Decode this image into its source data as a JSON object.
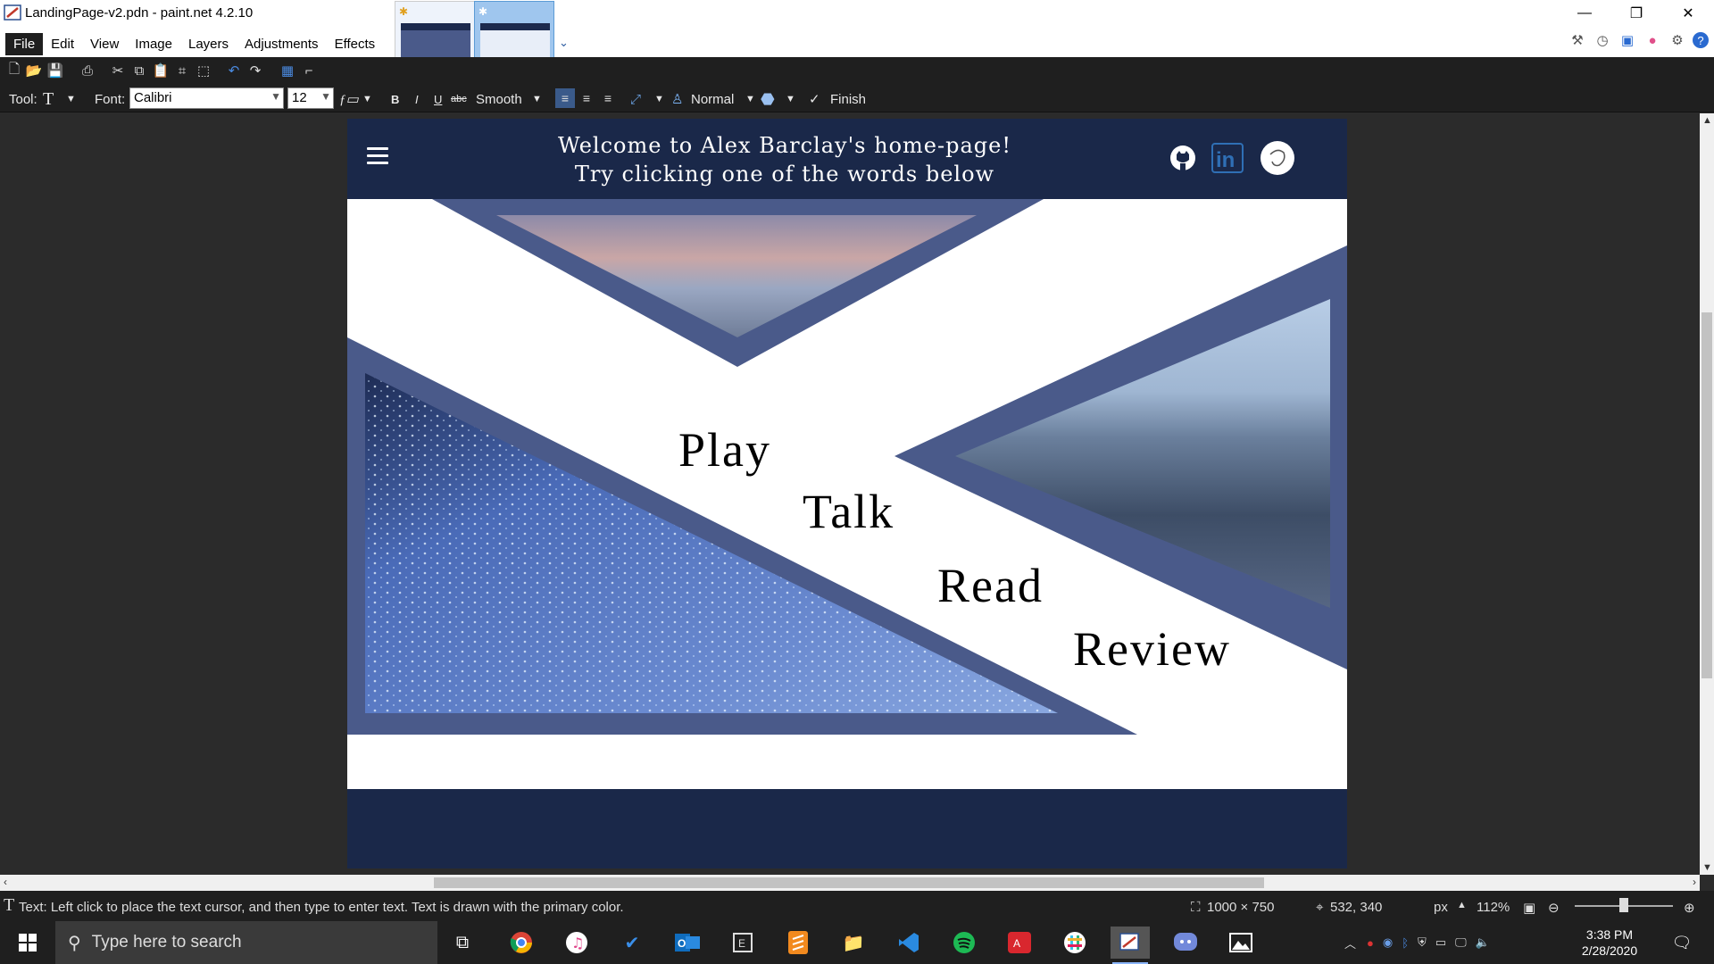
{
  "window": {
    "title": "LandingPage-v2.pdn - paint.net 4.2.10",
    "menu": [
      "File",
      "Edit",
      "View",
      "Image",
      "Layers",
      "Adjustments",
      "Effects"
    ]
  },
  "toolbar": {
    "tool_label": "Tool:",
    "font_label": "Font:",
    "font_value": "Calibri",
    "size_value": "12",
    "bold": "B",
    "italic": "I",
    "underline": "U",
    "strike": "abc",
    "antialias": "Smooth",
    "blend_mode": "Normal",
    "finish": "Finish"
  },
  "document": {
    "welcome_line1": "Welcome to Alex Barclay's home-page!",
    "welcome_line2": "Try clicking one of the words below",
    "nav_words": [
      "Play",
      "Talk",
      "Read",
      "Review"
    ],
    "social_icons": [
      "github-icon",
      "linkedin-icon",
      "profile-avatar-icon"
    ],
    "colors": {
      "header": "#1a2849",
      "accent": "#4a5a8a",
      "background": "#ffffff"
    }
  },
  "status": {
    "hint": "Text: Left click to place the text cursor, and then type to enter text. Text is drawn with the primary color.",
    "image_size": "1000 × 750",
    "cursor_pos": "532, 340",
    "units": "px",
    "zoom": "112%"
  },
  "taskbar": {
    "search_placeholder": "Type here to search",
    "time": "3:38 PM",
    "date": "2/28/2020",
    "apps": [
      "task-view",
      "chrome",
      "itunes",
      "todo",
      "outlook",
      "epic",
      "sublime",
      "file-explorer",
      "vscode",
      "spotify",
      "acrobat",
      "slack",
      "paintnet",
      "discord",
      "photos"
    ]
  }
}
